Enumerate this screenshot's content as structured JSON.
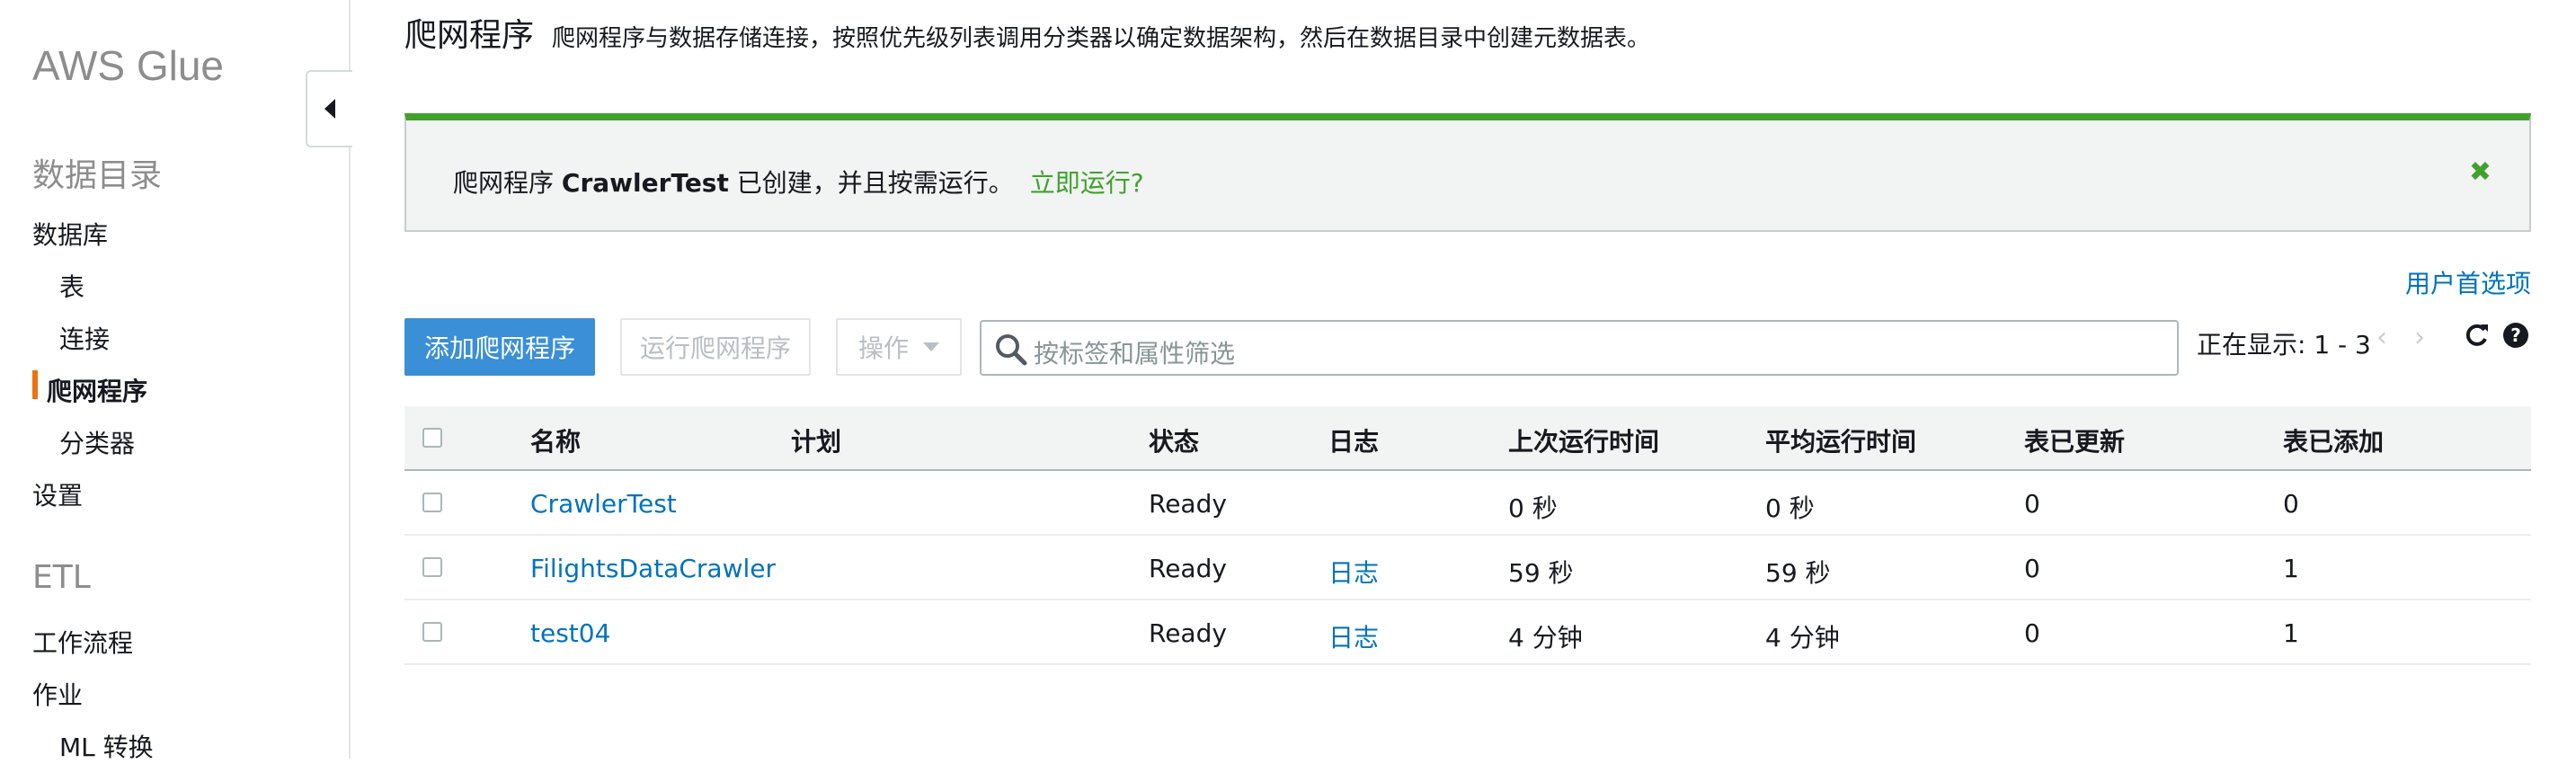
{
  "sidebar": {
    "brand": "AWS Glue",
    "catalog_title": "数据目录",
    "items": {
      "databases": "数据库",
      "tables": "表",
      "connections": "连接",
      "crawlers": "爬网程序",
      "classifiers": "分类器",
      "settings": "设置"
    },
    "etl_title": "ETL",
    "etl_items": {
      "workflows": "工作流程",
      "jobs": "作业",
      "ml_transforms": "ML 转换"
    }
  },
  "header": {
    "title": "爬网程序",
    "description": "爬网程序与数据存储连接，按照优先级列表调用分类器以确定数据架构，然后在数据目录中创建元数据表。"
  },
  "flash": {
    "prefix": "爬网程序",
    "crawler_name": "CrawlerTest",
    "suffix": "已创建，并且按需运行。",
    "run_now": "立即运行?",
    "close_icon": "close-x-icon",
    "accent_color": "#3fa22c"
  },
  "toolbar": {
    "user_preferences": "用户首选项",
    "add_crawler": "添加爬网程序",
    "run_crawler": "运行爬网程序",
    "actions": "操作",
    "search_placeholder": "按标签和属性筛选",
    "showing": "正在显示: 1 - 3"
  },
  "table": {
    "columns": {
      "name": "名称",
      "schedule": "计划",
      "status": "状态",
      "logs": "日志",
      "last_runtime": "上次运行时间",
      "median_runtime": "平均运行时间",
      "tables_updated": "表已更新",
      "tables_added": "表已添加"
    },
    "rows": [
      {
        "name": "CrawlerTest",
        "schedule": "",
        "status": "Ready",
        "logs": "",
        "last_runtime": "0 秒",
        "median_runtime": "0 秒",
        "tables_updated": "0",
        "tables_added": "0"
      },
      {
        "name": "FilightsDataCrawler",
        "schedule": "",
        "status": "Ready",
        "logs": "日志",
        "last_runtime": "59 秒",
        "median_runtime": "59 秒",
        "tables_updated": "0",
        "tables_added": "1"
      },
      {
        "name": "test04",
        "schedule": "",
        "status": "Ready",
        "logs": "日志",
        "last_runtime": "4 分钟",
        "median_runtime": "4 分钟",
        "tables_updated": "0",
        "tables_added": "1"
      }
    ]
  },
  "colors": {
    "primary_button": "#3a8fd6",
    "link": "#0073bb",
    "active_marker": "#ec7211"
  }
}
